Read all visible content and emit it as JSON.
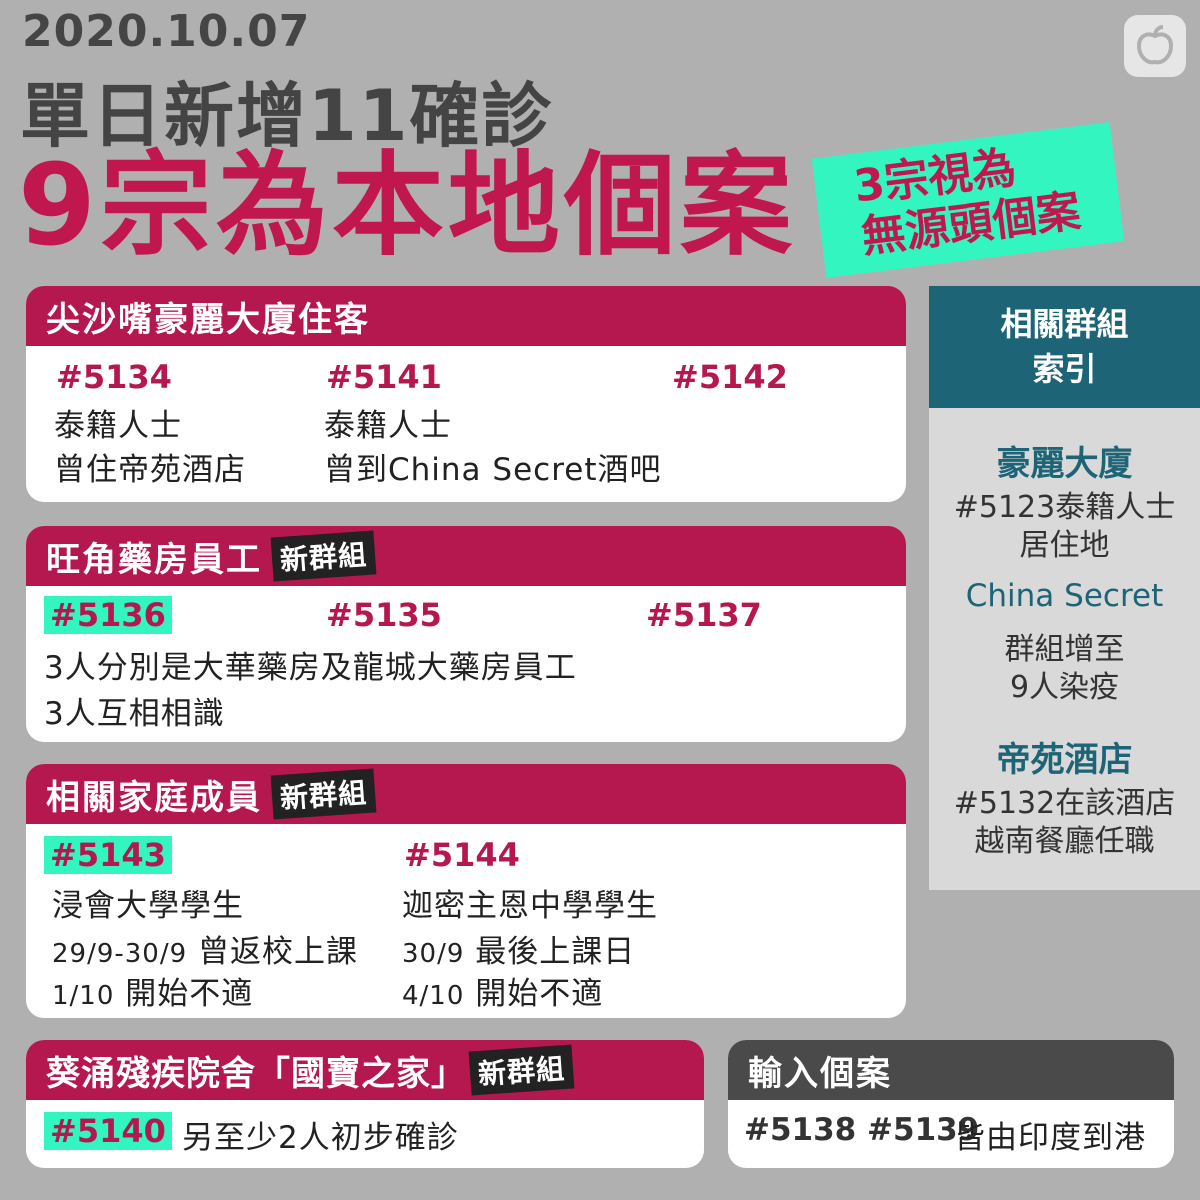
{
  "header": {
    "date": "2020.10.07",
    "headline": "單日新增11確診",
    "local": "9宗為本地個案",
    "tag_line1": "3宗視為",
    "tag_line2": "無源頭個案"
  },
  "new_cluster_label": "新群組",
  "cards": {
    "tst": {
      "title": "尖沙嘴豪麗大廈住客",
      "c1_id": "#5134",
      "c1_l1": "泰籍人士",
      "c1_l2": "曾住帝苑酒店",
      "c2_id": "#5141",
      "c2_l1": "泰籍人士",
      "c2_l2": "曾到China Secret酒吧",
      "c3_id": "#5142"
    },
    "mk": {
      "title": "旺角藥房員工",
      "c1_id": "#5136",
      "c2_id": "#5135",
      "c3_id": "#5137",
      "l1": "3人分別是大華藥房及龍城大藥房員工",
      "l2": "3人互相相識"
    },
    "family": {
      "title": "相關家庭成員",
      "c1_id": "#5143",
      "c1_l1": "浸會大學學生",
      "c1_d1": "29/9-30/9",
      "c1_d1t": "曾返校上課",
      "c1_d2": "1/10",
      "c1_d2t": "開始不適",
      "c2_id": "#5144",
      "c2_l1": "迦密主恩中學學生",
      "c2_d1": "30/9",
      "c2_d1t": "最後上課日",
      "c2_d2": "4/10",
      "c2_d2t": "開始不適"
    },
    "kc": {
      "title": "葵涌殘疾院舍「國寶之家」",
      "c1_id": "#5140",
      "l1": "另至少2人初步確診"
    },
    "imported": {
      "title": "輸入個案",
      "ids": "#5138 #5139",
      "l1": "皆由印度到港"
    }
  },
  "sidebar": {
    "head_l1": "相關群組",
    "head_l2": "索引",
    "s1_title": "豪麗大廈",
    "s1_l1": "#5123泰籍人士",
    "s1_l2": "居住地",
    "s2_title": "China Secret",
    "s2_l1": "群組增至",
    "s2_l2": "9人染疫",
    "s3_title": "帝苑酒店",
    "s3_l1": "#5132在該酒店",
    "s3_l2": "越南餐廳任職"
  },
  "colors": {
    "background": "#b0b0b0",
    "crimson": "#b5174f",
    "mint": "#33f5bf",
    "teal": "#1d6477",
    "charcoal": "#4a4a4a"
  },
  "logo_icon": "apple-logo-icon"
}
